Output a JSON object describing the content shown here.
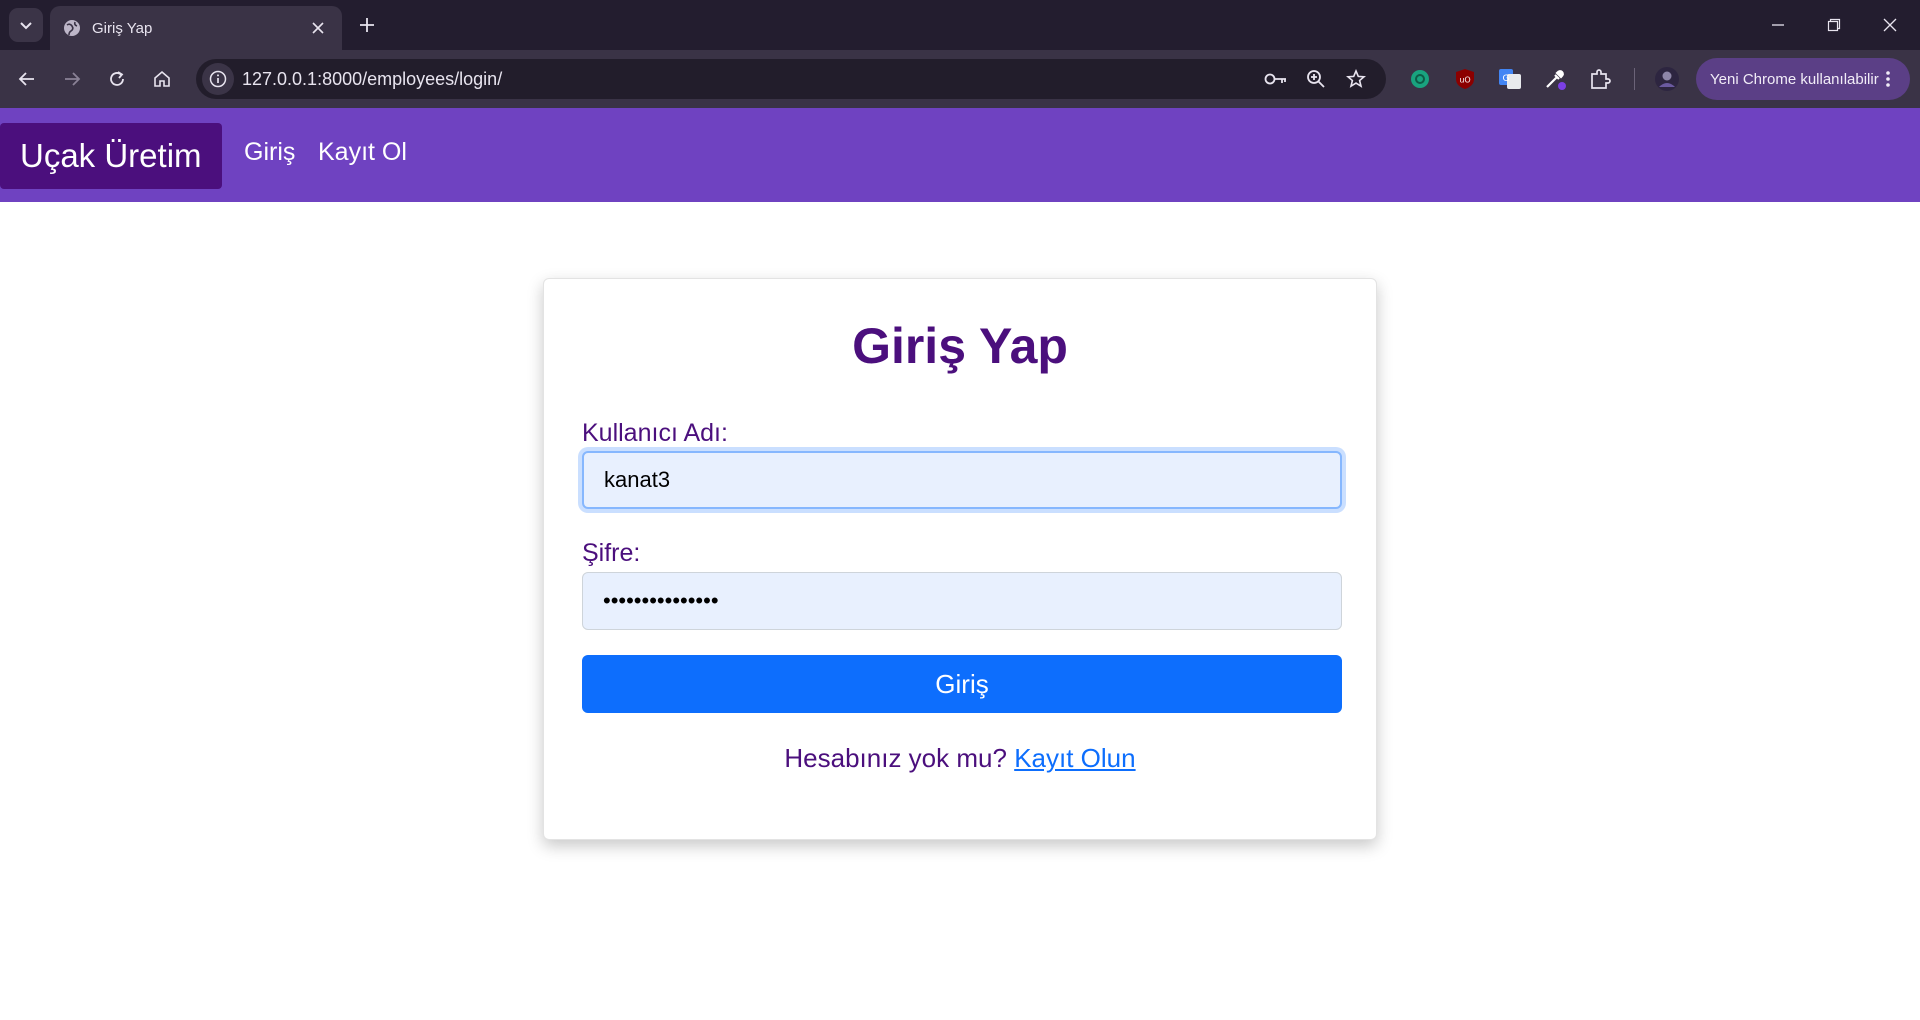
{
  "browser": {
    "tab_title": "Giriş Yap",
    "url": "127.0.0.1:8000/employees/login/",
    "update_label": "Yeni Chrome kullanılabilir",
    "icons": {
      "tab_search": "chevron-down-icon",
      "favicon": "globe-icon",
      "tab_close": "close-icon",
      "new_tab": "plus-icon",
      "back": "arrow-left-icon",
      "forward": "arrow-right-icon",
      "reload": "reload-icon",
      "home": "home-icon",
      "site_info": "info-icon",
      "password": "key-icon",
      "zoom": "zoom-icon",
      "bookmark": "star-icon",
      "extensions": [
        "chatgpt-icon",
        "ublock-icon",
        "translate-icon",
        "eyedropper-icon",
        "puzzle-icon"
      ],
      "profile": "avatar-icon",
      "menu": "more-vert-icon"
    }
  },
  "site": {
    "brand": "Uçak Üretim",
    "nav": [
      {
        "label": "Giriş"
      },
      {
        "label": "Kayıt Ol"
      }
    ]
  },
  "login": {
    "title": "Giriş Yap",
    "username_label": "Kullanıcı Adı:",
    "username_value": "kanat3",
    "password_label": "Şifre:",
    "password_value": "•••••••••••••••",
    "submit_label": "Giriş",
    "signup_prompt": "Hesabınız yok mu?",
    "signup_link": "Kayıt Olun"
  },
  "colors": {
    "navbar": "#6f42c1",
    "brand_bg": "#4b0f7d",
    "text_purple": "#4b0f7d",
    "primary_button": "#0d6efd",
    "input_bg": "#e8f0fe"
  }
}
